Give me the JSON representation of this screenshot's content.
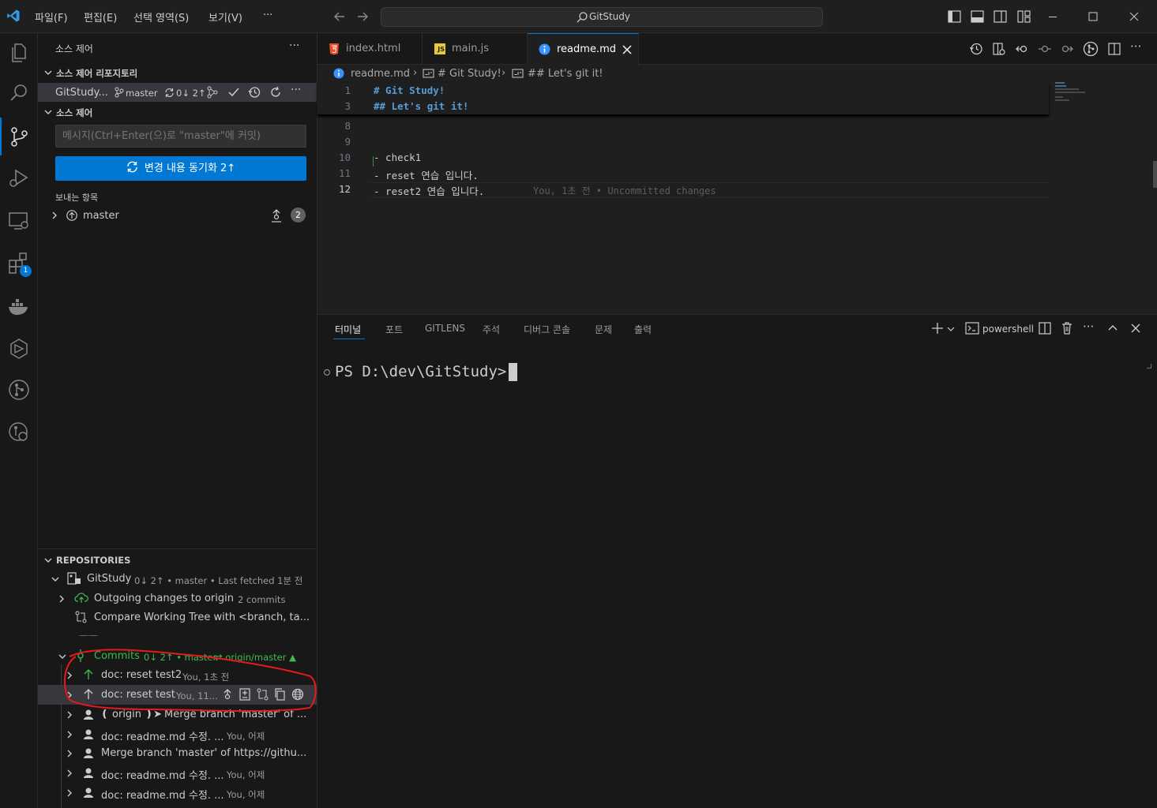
{
  "window": {
    "title": "GitStudy",
    "menu": [
      "파일(F)",
      "편집(E)",
      "선택 영역(S)",
      "보기(V)",
      "···"
    ]
  },
  "activity": {
    "extensions_badge": "1"
  },
  "sidebar": {
    "title": "소스 제어",
    "repos_section": "소스 제어 리포지토리",
    "repo": {
      "name": "GitStudy...",
      "branch": "master",
      "sync": "0↓ 2↑"
    },
    "scm_section": "소스 제어",
    "commit_placeholder": "메시지(Ctrl+Enter(으)로 \"master\"에 커밋)",
    "sync_button": "변경 내용 동기화 2↑",
    "outgoing_label": "보내는 항목",
    "outgoing_branch": "master",
    "outgoing_count": "2",
    "repositories_section": "REPOSITORIES",
    "gl_repo": {
      "name": "GitStudy",
      "meta": "0↓ 2↑ • master • Last fetched 1분 전"
    },
    "outgoing_changes": {
      "label": "Outgoing changes to origin",
      "meta": "2 commits"
    },
    "compare": "Compare Working Tree with <branch, ta...",
    "separator": "——",
    "commits": {
      "label": "Commits",
      "meta": "0↓ 2↑ • master",
      "remote": "⇄  origin/master ▲"
    },
    "commit_list": [
      {
        "msg": "doc: reset test2",
        "meta": "You, 1초 전"
      },
      {
        "msg": "doc: reset test",
        "meta": "You, 11..."
      },
      {
        "tag": "❪ origin ❫➤",
        "msg": "Merge branch 'master' of ...",
        "meta": ""
      },
      {
        "msg": "doc: readme.md 수정. ...",
        "meta": "You, 어제"
      },
      {
        "msg": "Merge branch 'master' of https://githu...",
        "meta": ""
      },
      {
        "msg": "doc: readme.md 수정. ...",
        "meta": "You, 어제"
      },
      {
        "msg": "doc: readme.md 수정. ...",
        "meta": "You, 어제"
      }
    ]
  },
  "editor": {
    "tabs": [
      {
        "label": "index.html",
        "icon": "html5-icon"
      },
      {
        "label": "main.js",
        "icon": "js-icon"
      },
      {
        "label": "readme.md",
        "icon": "info-icon"
      }
    ],
    "breadcrumb": [
      "readme.md",
      "# Git Study!",
      "## Let's git it!"
    ],
    "sticky": [
      {
        "num": "1",
        "text": "# Git Study!"
      },
      {
        "num": "3",
        "text": "## Let's git it!"
      }
    ],
    "lines": [
      {
        "num": "8",
        "text": ""
      },
      {
        "num": "9",
        "text": ""
      },
      {
        "num": "10",
        "text": "- check1"
      },
      {
        "num": "11",
        "text": "- reset 연습 입니다."
      },
      {
        "num": "12",
        "text": "- reset2 연습 입니다."
      }
    ],
    "blame": "You, 1초 전 • Uncommitted changes"
  },
  "panel": {
    "tabs": [
      "터미널",
      "포트",
      "GITLENS",
      "주석",
      "디버그 콘솔",
      "문제",
      "출력"
    ],
    "shell": "powershell",
    "prompt": "PS D:\\dev\\GitStudy>"
  },
  "colors": {
    "accent": "#0078d4",
    "annotation": "#e51b1b",
    "gitlens_green": "#3fb950"
  }
}
